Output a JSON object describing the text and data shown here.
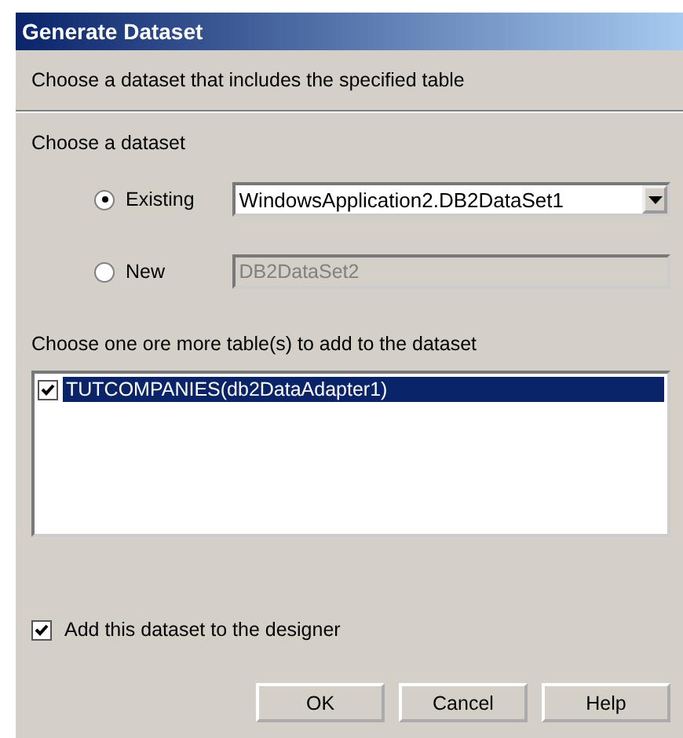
{
  "window": {
    "title": "Generate Dataset"
  },
  "header": "Choose a dataset that includes the specified table",
  "dataset_group": {
    "label": "Choose a dataset",
    "options": [
      {
        "kind": "dropdown",
        "label": "Existing",
        "selected": true,
        "value": "WindowsApplication2.DB2DataSet1",
        "disabled": false
      },
      {
        "kind": "text",
        "label": "New",
        "selected": false,
        "value": "DB2DataSet2",
        "disabled": true
      }
    ]
  },
  "tables": {
    "label": "Choose one ore more table(s) to add to the dataset",
    "items": [
      {
        "label": "TUTCOMPANIES(db2DataAdapter1)",
        "checked": true,
        "selected": true
      }
    ]
  },
  "add_to_designer": {
    "label": "Add this dataset to the designer",
    "checked": true
  },
  "buttons": [
    "OK",
    "Cancel",
    "Help"
  ]
}
